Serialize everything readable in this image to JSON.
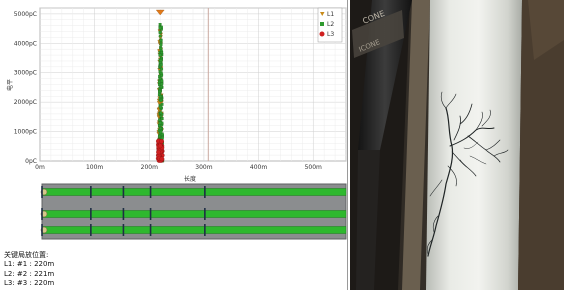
{
  "chart_data": {
    "type": "scatter",
    "ylabel": "电平",
    "xlabel": "长度",
    "x_ticks": [
      "0m",
      "100m",
      "200m",
      "300m",
      "400m",
      "500m"
    ],
    "y_ticks": [
      "0pC",
      "1000pC",
      "2000pC",
      "3000pC",
      "4000pC",
      "5000pC"
    ],
    "xlim": [
      0,
      560
    ],
    "ylim": [
      0,
      5200
    ],
    "cursor_x": 308,
    "legend": [
      "L1",
      "L2",
      "L3"
    ],
    "series": [
      {
        "name": "L1",
        "marker": "triangle-down",
        "color": "#c88a18",
        "x_center": 220,
        "y_max": 4700
      },
      {
        "name": "L2",
        "marker": "square",
        "color": "#2f9a2f",
        "x_center": 221,
        "y_max": 4700
      },
      {
        "name": "L3",
        "marker": "circle",
        "color": "#d02020",
        "x_center": 220,
        "y_max": 700
      }
    ]
  },
  "cable": {
    "lines": [
      "L1",
      "L2",
      "L3"
    ],
    "tick_x_m": [
      0,
      90,
      150,
      200,
      300
    ]
  },
  "locations": {
    "title": "关键局放位置:",
    "items": [
      "L1: #1 : 220m",
      "L2: #2 : 221m",
      "L3: #3 : 220m"
    ]
  },
  "photo": {
    "subject": "cable insulation with electrical treeing damage",
    "colors": {
      "cable": "#e6e8e2",
      "background": "#2d2a26",
      "tree": "#1f2425"
    }
  }
}
